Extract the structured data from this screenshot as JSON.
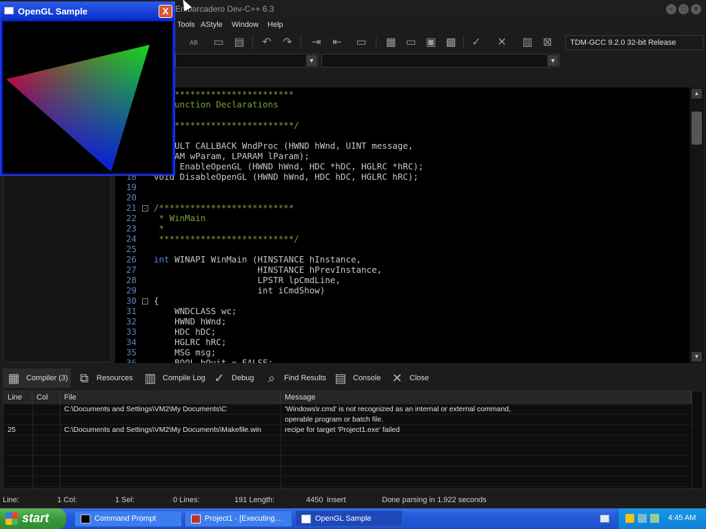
{
  "devcpp": {
    "title": "Embarcadero Dev-C++ 6.3",
    "menu": [
      "Tools",
      "AStyle",
      "Window",
      "Help"
    ],
    "compiler": "TDM-GCC 9.2.0 32-bit Release",
    "code_lines": [
      {
        "n": "",
        "text": "/**************************",
        "cls": "cm"
      },
      {
        "n": "",
        "text": " * Function Declarations",
        "cls": "cm"
      },
      {
        "n": "",
        "text": " *",
        "cls": "cm"
      },
      {
        "n": "",
        "text": " **************************/",
        "cls": "cm"
      },
      {
        "n": "",
        "text": "",
        "cls": ""
      },
      {
        "n": "",
        "text": "LRESULT CALLBACK WndProc (HWND hWnd, UINT message,",
        "cls": ""
      },
      {
        "n": "",
        "text": "WPARAM wParam, LPARAM lParam);",
        "cls": ""
      },
      {
        "n": "",
        "text": "void EnableOpenGL (HWND hWnd, HDC *hDC, HGLRC *hRC);",
        "cls": ""
      },
      {
        "n": "18",
        "text": "void DisableOpenGL (HWND hWnd, HDC hDC, HGLRC hRC);",
        "cls": ""
      },
      {
        "n": "19",
        "text": "",
        "cls": ""
      },
      {
        "n": "20",
        "text": "",
        "cls": ""
      },
      {
        "n": "21",
        "text": "/**************************",
        "cls": "cm",
        "fold": "-"
      },
      {
        "n": "22",
        "text": " * WinMain",
        "cls": "cm"
      },
      {
        "n": "23",
        "text": " *",
        "cls": "cm"
      },
      {
        "n": "24",
        "text": " **************************/",
        "cls": "cm"
      },
      {
        "n": "25",
        "text": "",
        "cls": ""
      },
      {
        "n": "26",
        "text": "int WINAPI WinMain (HINSTANCE hInstance,",
        "cls": "",
        "kw": "int"
      },
      {
        "n": "27",
        "text": "                    HINSTANCE hPrevInstance,",
        "cls": ""
      },
      {
        "n": "28",
        "text": "                    LPSTR lpCmdLine,",
        "cls": ""
      },
      {
        "n": "29",
        "text": "                    int iCmdShow)",
        "cls": ""
      },
      {
        "n": "30",
        "text": "{",
        "cls": "",
        "fold": "-"
      },
      {
        "n": "31",
        "text": "    WNDCLASS wc;",
        "cls": ""
      },
      {
        "n": "32",
        "text": "    HWND hWnd;",
        "cls": ""
      },
      {
        "n": "33",
        "text": "    HDC hDC;",
        "cls": ""
      },
      {
        "n": "34",
        "text": "    HGLRC hRC;",
        "cls": ""
      },
      {
        "n": "35",
        "text": "    MSG msg;",
        "cls": ""
      },
      {
        "n": "36",
        "text": "    BOOL bQuit = FALSE;",
        "cls": ""
      }
    ],
    "bottom_tabs": [
      {
        "label": "Compiler (3)",
        "icon": "compiler-icon"
      },
      {
        "label": "Resources",
        "icon": "resources-icon"
      },
      {
        "label": "Compile Log",
        "icon": "compile-log-icon"
      },
      {
        "label": "Debug",
        "icon": "debug-icon"
      },
      {
        "label": "Find Results",
        "icon": "find-results-icon"
      },
      {
        "label": "Console",
        "icon": "console-icon"
      },
      {
        "label": "Close",
        "icon": "close-icon"
      }
    ],
    "table": {
      "headers": [
        "Line",
        "Col",
        "File",
        "Message"
      ],
      "rows": [
        {
          "line": "",
          "col": "",
          "file": "C:\\Documents and Settings\\VM2\\My Documents\\C",
          "message": "'Windows\\r.cmd' is not recognized as an internal or external command,"
        },
        {
          "line": "",
          "col": "",
          "file": "",
          "message": "operable program or batch file."
        },
        {
          "line": "25",
          "col": "",
          "file": "C:\\Documents and Settings\\VM2\\My Documents\\Makefile.win",
          "message": "recipe for target 'Project1.exe' failed"
        }
      ]
    },
    "status": {
      "line_label": "Line:",
      "line_val": "1 Col:",
      "col_val": "1 Sel:",
      "sel_val": "0 Lines:",
      "lines_val": "191 Length:",
      "length_val": "4450",
      "mode": "Insert",
      "parse": "Done parsing in 1.922 seconds"
    }
  },
  "opengl": {
    "title": "OpenGL Sample",
    "close": "X"
  },
  "taskbar": {
    "start": "start",
    "tasks": [
      "Command Prompt",
      "Project1 - [Executing...",
      "OpenGL Sample"
    ],
    "clock": "4:45 AM"
  }
}
